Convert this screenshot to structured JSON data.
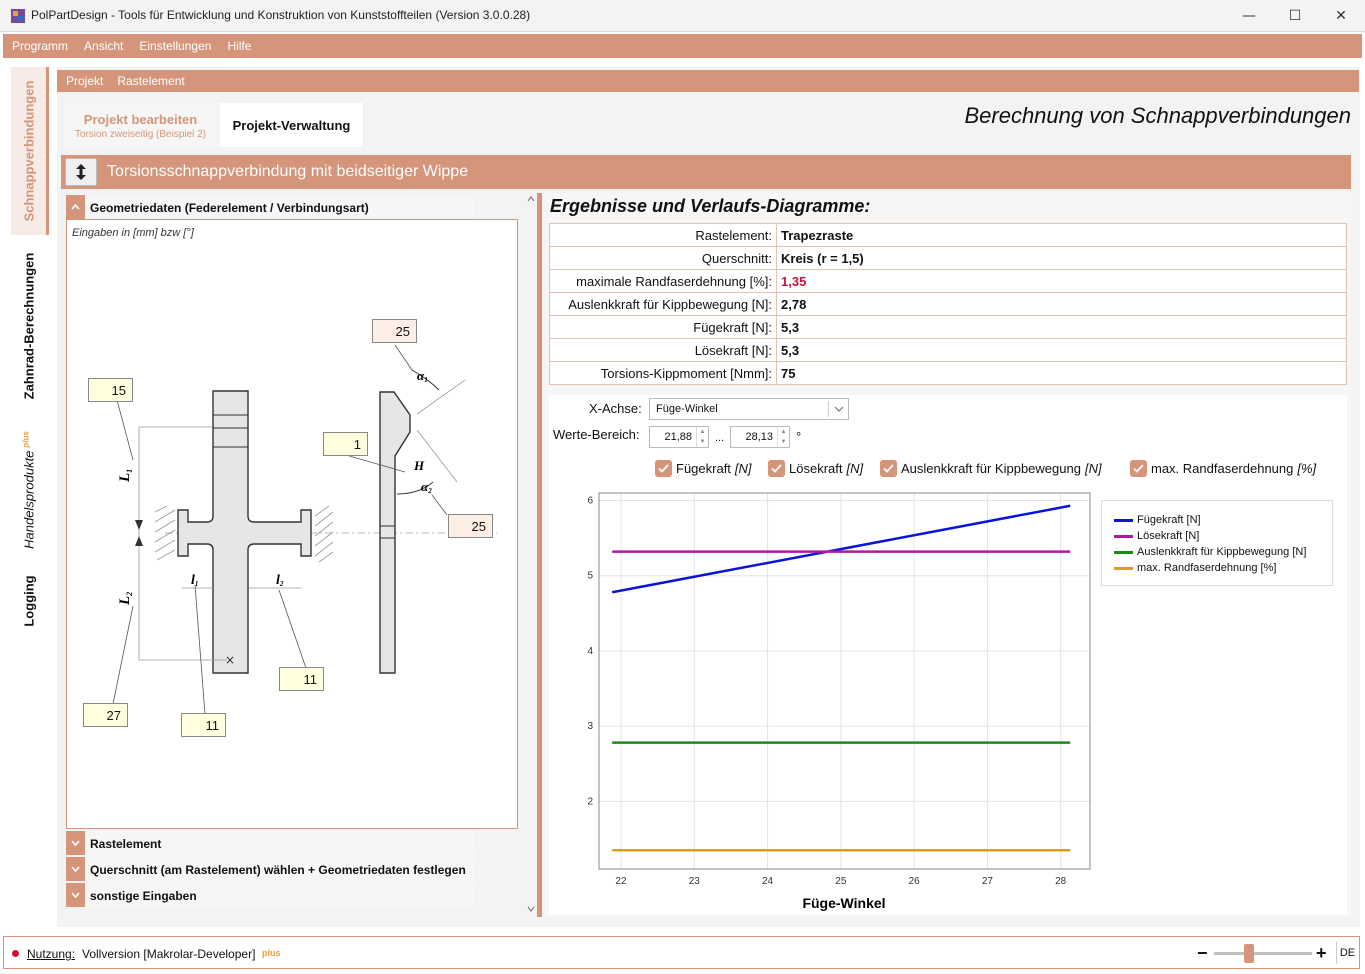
{
  "window": {
    "title": "PolPartDesign - Tools für Entwicklung und Konstruktion von Kunststoffteilen (Version 3.0.0.28)",
    "controls": {
      "minimize": "—",
      "maximize": "☐",
      "close": "✕"
    }
  },
  "menu": [
    "Programm",
    "Ansicht",
    "Einstellungen",
    "Hilfe"
  ],
  "sidebar": {
    "tabs": [
      {
        "label": "Schnappverbindungen",
        "active": true
      },
      {
        "label": "Zahnrad-Berechnungen",
        "active": false
      },
      {
        "label": "Handelsprodukte",
        "active": false,
        "badge": "plus"
      },
      {
        "label": "Logging",
        "active": false
      }
    ]
  },
  "breadcrumb": [
    "Projekt",
    "Rastelement"
  ],
  "project_tabs": {
    "edit": {
      "title": "Projekt bearbeiten",
      "subtitle": "Torsion zweiseitig (Beispiel 2)"
    },
    "manage": {
      "title": "Projekt-Verwaltung"
    }
  },
  "page_heading": "Berechnung von Schnappverbindungen",
  "section_title": "Torsionsschnappverbindung mit beidseitiger Wippe",
  "accordion": {
    "geometry": "Geometriedaten (Federelement / Verbindungsart)",
    "rastelement": "Rastelement",
    "querschnitt": "Querschnitt (am Rastelement) wählen + Geometriedaten festlegen",
    "sonstige": "sonstige Eingaben"
  },
  "geometry": {
    "note": "Eingaben in [mm] bzw [°]",
    "inputs": {
      "L1": "15",
      "L2": "27",
      "l1": "11",
      "l2": "11",
      "H": "1",
      "alpha1": "25",
      "alpha2": "25"
    },
    "labels": {
      "L1": "L",
      "L1_sub": "1",
      "L2": "L",
      "L2_sub": "2",
      "l1": "l",
      "l1_sub": "1",
      "l2": "l",
      "l2_sub": "2",
      "H": "H",
      "a1": "α",
      "a1_sub": "1",
      "a2": "α",
      "a2_sub": "2"
    }
  },
  "results": {
    "title": "Ergebnisse und Verlaufs-Diagramme:",
    "rows": [
      {
        "label": "Rastelement:",
        "value": "Trapezraste"
      },
      {
        "label": "Querschnitt:",
        "value": "Kreis (r = 1,5)"
      },
      {
        "label": "maximale Randfaserdehnung [%]:",
        "value": "1,35",
        "highlight": true
      },
      {
        "label": "Auslenkkraft für Kippbewegung [N]:",
        "value": "2,78"
      },
      {
        "label": "Fügekraft [N]:",
        "value": "5,3"
      },
      {
        "label": "Lösekraft [N]:",
        "value": "5,3"
      },
      {
        "label": "Torsions-Kippmoment [Nmm]:",
        "value": "75"
      }
    ]
  },
  "controls": {
    "xaxis_label": "X-Achse:",
    "xaxis_value": "Füge-Winkel",
    "range_label": "Werte-Bereich:",
    "range_from": "21,88",
    "range_sep": "...",
    "range_to": "28,13",
    "range_unit": "°",
    "checkboxes": [
      {
        "label": "Fügekraft",
        "unit": "[N]",
        "checked": true
      },
      {
        "label": "Lösekraft",
        "unit": "[N]",
        "checked": true
      },
      {
        "label": "Auslenkkraft für Kippbewegung",
        "unit": "[N]",
        "checked": true
      },
      {
        "label": "max. Randfaserdehnung",
        "unit": "[%]",
        "checked": true
      }
    ]
  },
  "chart_data": {
    "type": "line",
    "xlabel": "Füge-Winkel",
    "ylabel": "",
    "xlim": [
      21.7,
      28.4
    ],
    "ylim": [
      1.1,
      6.1
    ],
    "xticks": [
      22,
      23,
      24,
      25,
      26,
      27,
      28
    ],
    "yticks": [
      2,
      3,
      4,
      5,
      6
    ],
    "grid": true,
    "legend_position": "right",
    "series": [
      {
        "name": "Fügekraft [N]",
        "color": "#0a14d6",
        "x": [
          21.88,
          28.13
        ],
        "y": [
          4.78,
          5.93
        ]
      },
      {
        "name": "Lösekraft [N]",
        "color": "#b01aa0",
        "x": [
          21.88,
          28.13
        ],
        "y": [
          5.32,
          5.32
        ]
      },
      {
        "name": "Auslenkkraft für Kippbewegung [N]",
        "color": "#1a8a1a",
        "x": [
          21.88,
          28.13
        ],
        "y": [
          2.78,
          2.78
        ]
      },
      {
        "name": "max. Randfaserdehnung [%]",
        "color": "#d9a020",
        "x": [
          21.88,
          28.13
        ],
        "y": [
          1.35,
          1.35
        ]
      }
    ]
  },
  "status": {
    "label": "Nutzung:",
    "value": "Vollversion [Makrolar-Developer]",
    "badge": "plus",
    "lang": "DE",
    "zoom_minus": "−",
    "zoom_plus": "+"
  },
  "colors": {
    "accent": "#d4957a",
    "highlight": "#c0143c"
  }
}
